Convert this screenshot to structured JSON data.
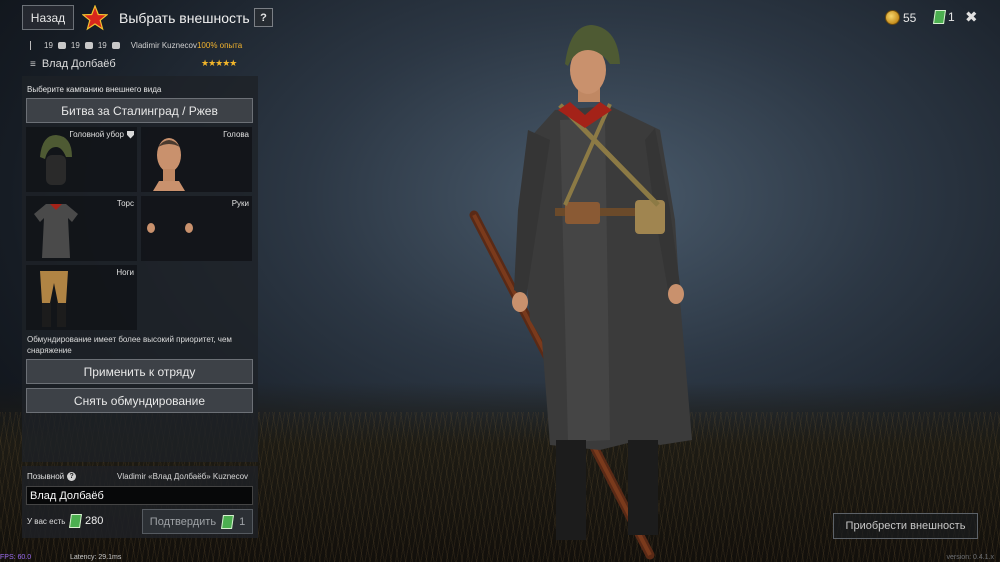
{
  "header": {
    "back_label": "Назад",
    "title": "Выбрать внешность",
    "help_label": "?",
    "gold": "55",
    "tickets": "1",
    "close_label": "✖"
  },
  "soldier": {
    "stat1": "19",
    "stat2": "19",
    "stat3": "19",
    "owner": "Vladimir Kuznecov",
    "exp": "100% опыта",
    "name": "Влад Долбаёб",
    "stars": "★★★★★"
  },
  "appearance": {
    "caption": "Выберите кампанию внешнего вида",
    "campaign": "Битва за Сталинград / Ржев",
    "slots": [
      {
        "label": "Головной убор"
      },
      {
        "label": "Голова"
      },
      {
        "label": "Торс"
      },
      {
        "label": "Руки"
      },
      {
        "label": "Ноги"
      }
    ],
    "note": "Обмундирование имеет более высокий приоритет, чем снаряжение",
    "apply_label": "Применить к отряду",
    "remove_label": "Снять обмундирование"
  },
  "callsign": {
    "label": "Позывной",
    "full_name": "Vladimir «Влад Долбаёб» Kuznecov",
    "value": "Влад Долбаёб",
    "have_label": "У вас есть",
    "have_value": "280",
    "confirm_label": "Подтвердить",
    "confirm_cost": "1"
  },
  "buy_label": "Приобрести внешность",
  "debug": {
    "fps": "FPS: 60.0",
    "latency": "Latency: 29.1ms",
    "version": "version: 0.4.1.x"
  },
  "colors": {
    "accent_gold": "#f2b32e",
    "star_red": "#d8261c",
    "ticket_green": "#4caf50"
  }
}
